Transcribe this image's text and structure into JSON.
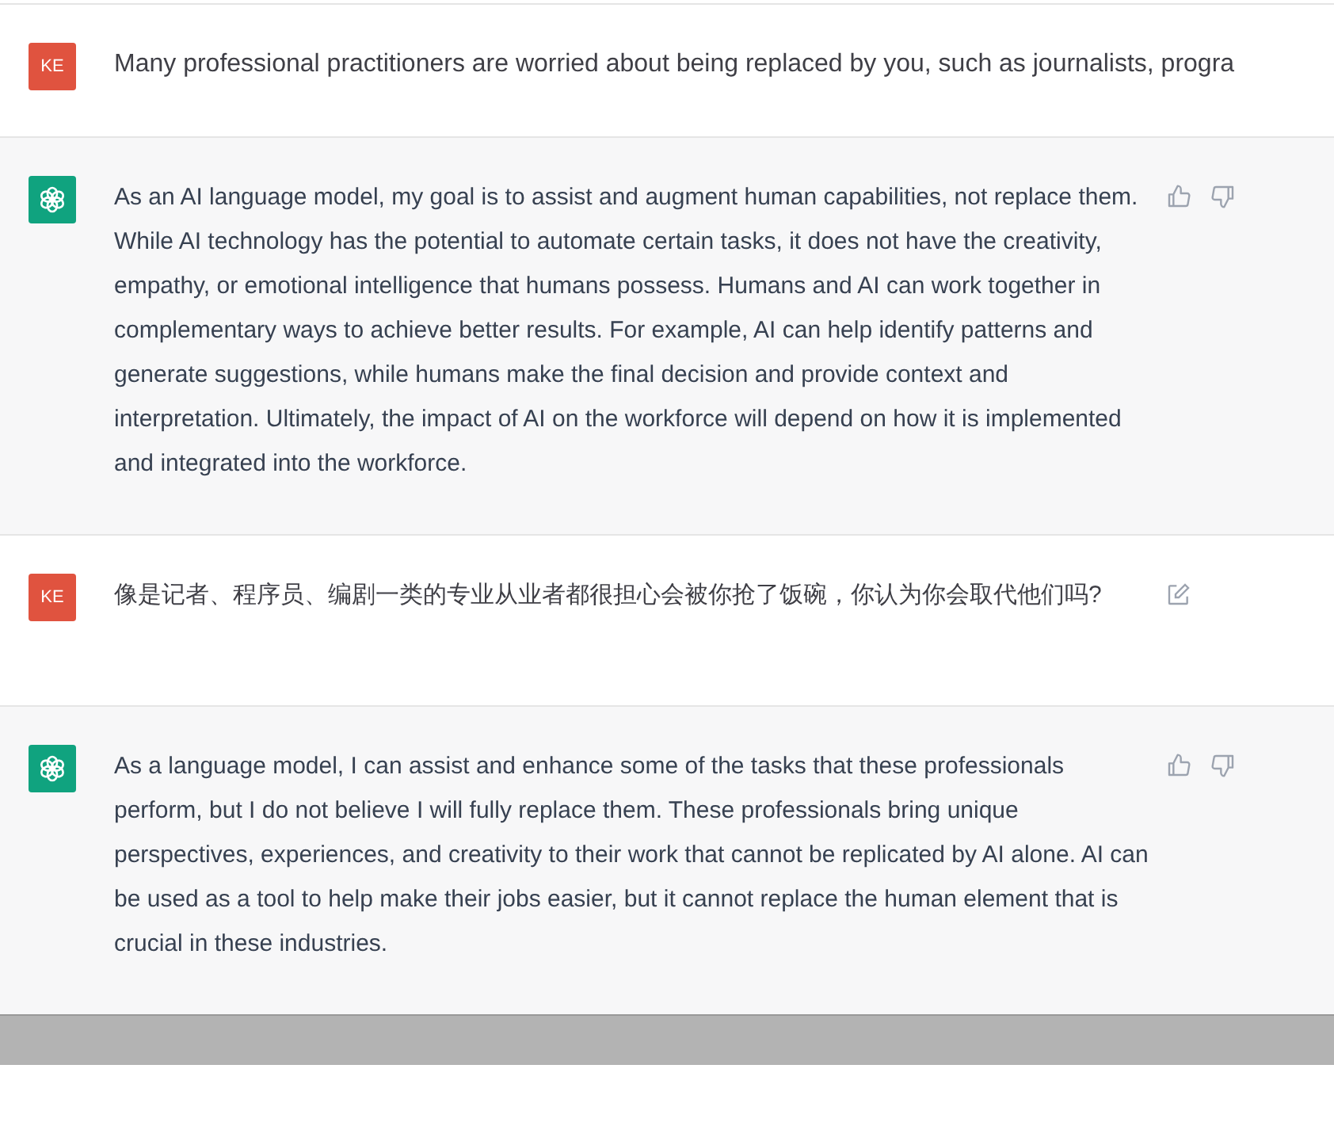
{
  "messages": [
    {
      "kind": "user",
      "avatar": "KE",
      "text": "Many professional practitioners are worried about being replaced by you, such as journalists, progra",
      "cut_off": true
    },
    {
      "kind": "assistant",
      "text": "As an AI language model, my goal is to assist and augment human capabilities, not replace them. While AI technology has the potential to automate certain tasks, it does not have the creativity, empathy, or emotional intelligence that humans possess. Humans and AI can work together in complementary ways to achieve better results. For example, AI can help identify patterns and generate suggestions, while humans make the final decision and provide context and interpretation. Ultimately, the impact of AI on the workforce will depend on how it is implemented and integrated into the workforce."
    },
    {
      "kind": "user",
      "avatar": "KE",
      "text": "像是记者、程序员、编剧一类的专业从业者都很担心会被你抢了饭碗，你认为你会取代他们吗?"
    },
    {
      "kind": "assistant",
      "text": "As a language model, I can assist and enhance some of the tasks that these professionals perform, but I do not believe I will fully replace them. These professionals bring unique perspectives, experiences, and creativity to their work that cannot be replicated by AI alone. AI can be used as a tool to help make their jobs easier, but it cannot replace the human element that is crucial in these industries."
    }
  ]
}
